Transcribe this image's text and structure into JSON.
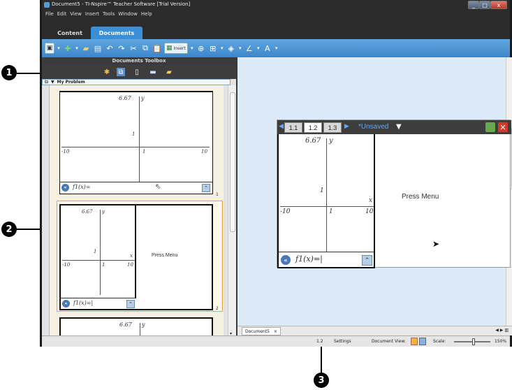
{
  "window": {
    "title": "Document5 - TI-Nspire™ Teacher Software [Trial Version]",
    "controls": [
      "_",
      "□",
      "x"
    ]
  },
  "menu": [
    "File",
    "Edit",
    "View",
    "Insert",
    "Tools",
    "Window",
    "Help"
  ],
  "top_tabs": [
    "Content",
    "Documents"
  ],
  "toolbar": {
    "insert_label": "Insert"
  },
  "toolbox": {
    "header": "Documents Toolbox",
    "problem_label": "My Problem"
  },
  "thumbnails": [
    {
      "page_number": "1",
      "y_max": "6.67",
      "y_label": "y",
      "y_tick": "1",
      "x_min": "-10",
      "x_tick": "1",
      "x_max": "10",
      "entry": "f1(x)="
    },
    {
      "page_number": "2",
      "y_max": "6.67",
      "y_label": "y",
      "y_tick": "1",
      "x_label": "x",
      "x_min": "-10",
      "x_tick": "1",
      "x_max": "10",
      "entry": "f1(x)=|",
      "press_menu": "Press Menu"
    },
    {
      "y_max": "6.67",
      "y_label": "y"
    }
  ],
  "document": {
    "page_tabs": [
      "1.1",
      "1.2",
      "1.3"
    ],
    "unsaved": "*Unsaved",
    "graph": {
      "y_max": "6.67",
      "y_label": "y",
      "y_tick": "1",
      "x_label": "x",
      "x_min": "-10",
      "x_tick": "1",
      "x_max": "10",
      "entry": "f1(x)=|"
    },
    "press_menu": "Press Menu"
  },
  "doc_tab": {
    "label": "Document5",
    "close": "×"
  },
  "status": {
    "page": "1.2",
    "settings": "Settings",
    "document_view": "Document View:",
    "scale_label": "Scale:",
    "scale_value": "150%"
  },
  "callouts": [
    "1",
    "2",
    "3"
  ]
}
